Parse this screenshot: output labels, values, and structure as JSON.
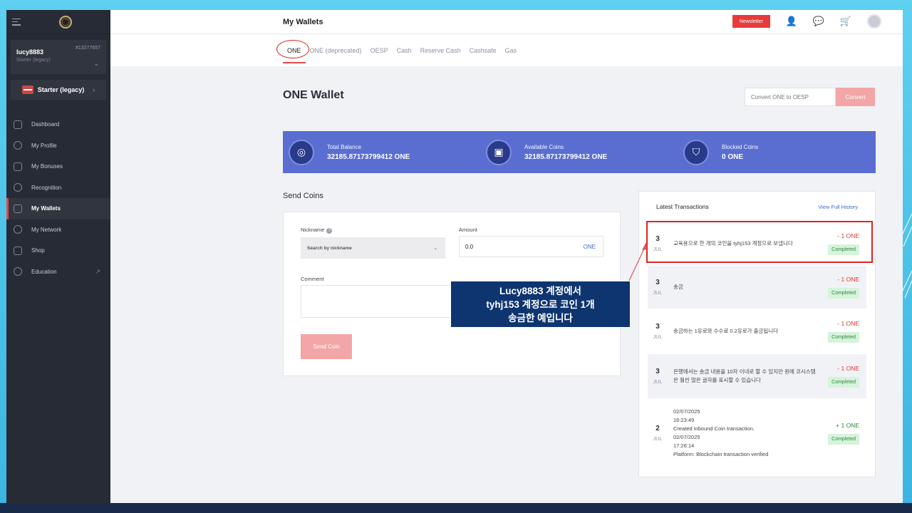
{
  "sidebar": {
    "user": {
      "name": "lucy8883",
      "tier": "Starter (legacy)",
      "id": "#13277657"
    },
    "plan": {
      "label": "Starter (legacy)"
    },
    "items": [
      {
        "label": "Dashboard",
        "icon": "home-icon"
      },
      {
        "label": "My Profile",
        "icon": "user-icon"
      },
      {
        "label": "My Bonuses",
        "icon": "gift-icon"
      },
      {
        "label": "Recognition",
        "icon": "star-icon"
      },
      {
        "label": "My Wallets",
        "icon": "wallet-icon",
        "active": true
      },
      {
        "label": "My Network",
        "icon": "network-icon"
      },
      {
        "label": "Shop",
        "icon": "cart-icon"
      },
      {
        "label": "Education",
        "icon": "education-icon"
      }
    ]
  },
  "header": {
    "title": "My Wallets",
    "newsletter": "Newsletter"
  },
  "tabs": [
    "ONE",
    "ONE (deprecated)",
    "OESP",
    "Cash",
    "Reserve Cash",
    "Cashsafe",
    "Gas"
  ],
  "wallet": {
    "title": "ONE Wallet",
    "convert_placeholder": "Convert ONE to OESP",
    "convert_button": "Convert"
  },
  "balances": [
    {
      "label": "Total Balance",
      "value": "32185.87173799412 ONE"
    },
    {
      "label": "Available Coins",
      "value": "32185.87173799412 ONE"
    },
    {
      "label": "Blocked Coins",
      "value": "0 ONE"
    }
  ],
  "send": {
    "title": "Send Coins",
    "nickname_label": "Nickname",
    "nickname_placeholder": "Search by nickname",
    "amount_label": "Amount",
    "amount_value": "0.0",
    "amount_unit": "ONE",
    "comment_label": "Comment",
    "button": "Send Coin"
  },
  "transactions": {
    "title": "Latest Transactions",
    "view_all": "View Full History",
    "rows": [
      {
        "day": "3",
        "month": "JUL",
        "desc": "교육용으로 한 개의 코인을 tyhj153 계정으로 보냅니다",
        "amount": "- 1 ONE",
        "status": "Completed"
      },
      {
        "day": "3",
        "month": "JUL",
        "desc": "송금",
        "amount": "- 1 ONE",
        "status": "Completed"
      },
      {
        "day": "3",
        "month": "JUL",
        "desc": "송금하는 1유로와 수수료 0.2유로가 출금됩니다",
        "amount": "- 1 ONE",
        "status": "Completed"
      },
      {
        "day": "3",
        "month": "JUL",
        "desc": "은행에서는 송금 내용을 10자 이내로 할 수 있지만 원에 코시스템은 훨씬 많은 글자를 표시할 수 있습니다",
        "amount": "- 1 ONE",
        "status": "Completed"
      },
      {
        "day": "2",
        "month": "JUL",
        "desc": "02/07/2025\n16:23:49\nCreated inbound Coin transaction.\n02/07/2025\n17:26:14\nPlatform: Blockchain transaction verified",
        "amount": "+ 1 ONE",
        "status": "Completed"
      }
    ]
  },
  "callout": {
    "line1": "Lucy8883 계정에서",
    "line2": "tyhj153 계정으로 코인 1개",
    "line3": "송금한 예입니다"
  }
}
